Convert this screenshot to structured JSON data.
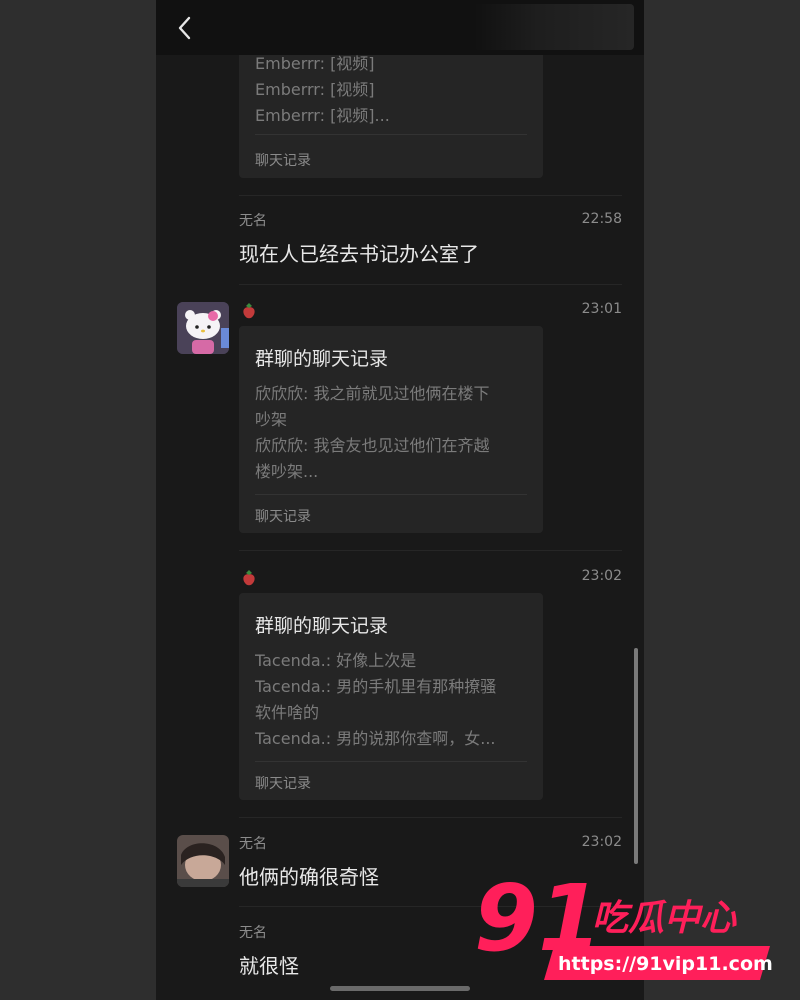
{
  "nav": {
    "back_icon": "chevron-left-icon"
  },
  "top_card": {
    "lines": [
      "Emberrr: [视频]",
      "Emberrr: [视频]",
      "Emberrr: [视频]..."
    ],
    "footer": "聊天记录"
  },
  "messages": [
    {
      "sender": "无名",
      "time": "22:58",
      "text": "现在人已经去书记办公室了"
    },
    {
      "sender_icon": "strawberry-icon",
      "time": "23:01",
      "card": {
        "title": "群聊的聊天记录",
        "lines": [
          "欣欣欣: 我之前就见过他俩在楼下",
          "吵架",
          "欣欣欣: 我舍友也见过他们在齐越",
          "楼吵架..."
        ],
        "footer": "聊天记录"
      }
    },
    {
      "sender_icon": "strawberry-icon",
      "time": "23:02",
      "card": {
        "title": "群聊的聊天记录",
        "lines": [
          "Tacenda.: 好像上次是",
          "Tacenda.: 男的手机里有那种撩骚",
          "软件啥的",
          "Tacenda.: 男的说那你查啊，女..."
        ],
        "footer": "聊天记录"
      }
    },
    {
      "sender": "无名",
      "time": "23:02",
      "text": "他俩的确很奇怪"
    },
    {
      "sender": "无名",
      "time": "",
      "text": "就很怪"
    }
  ],
  "watermark": {
    "number": "91",
    "brand": "吃瓜中心",
    "url": "https://91vip11.com",
    "color": "#ff1f5a"
  }
}
